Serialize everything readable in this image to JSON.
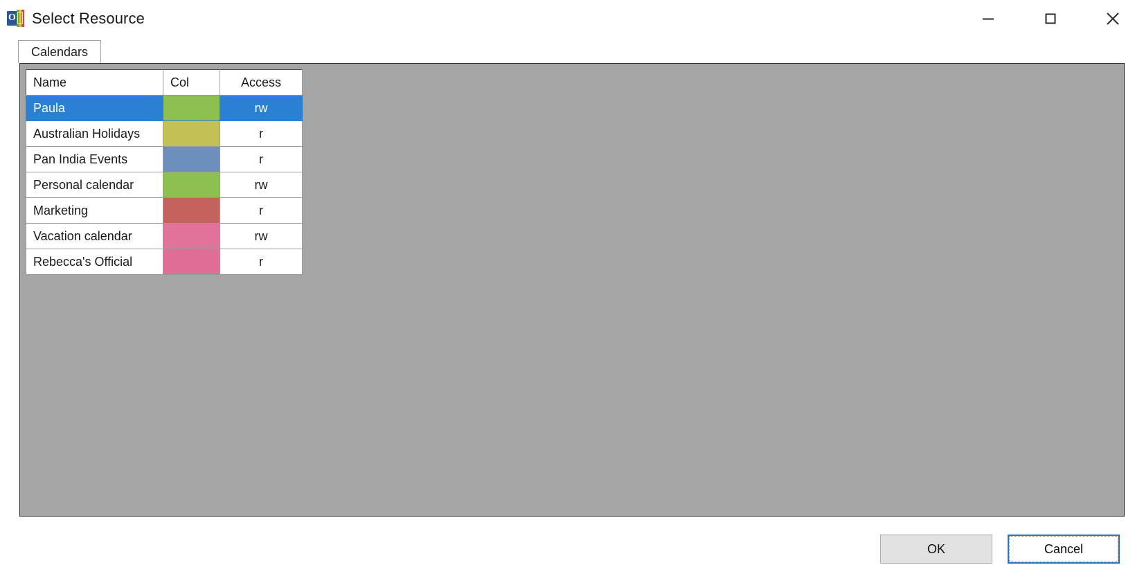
{
  "window": {
    "title": "Select Resource",
    "icon": "outlook-calendar-icon",
    "controls": {
      "minimize": "–",
      "maximize": "□",
      "close": "✕"
    }
  },
  "tabs": [
    {
      "label": "Calendars",
      "active": true
    }
  ],
  "grid": {
    "columns": [
      "Name",
      "Col",
      "Access"
    ],
    "rows": [
      {
        "name": "Paula",
        "color": "#8CC152",
        "access": "rw",
        "selected": true
      },
      {
        "name": "Australian Holidays",
        "color": "#C2C155",
        "access": "r",
        "selected": false
      },
      {
        "name": "Pan India Events",
        "color": "#6E8FBE",
        "access": "r",
        "selected": false
      },
      {
        "name": "Personal calendar",
        "color": "#8CC152",
        "access": "rw",
        "selected": false
      },
      {
        "name": "Marketing",
        "color": "#C4625D",
        "access": "r",
        "selected": false
      },
      {
        "name": "Vacation calendar",
        "color": "#E0729B",
        "access": "rw",
        "selected": false
      },
      {
        "name": "Rebecca's Official",
        "color": "#DE6E97",
        "access": "r",
        "selected": false
      }
    ]
  },
  "footer": {
    "ok_label": "OK",
    "cancel_label": "Cancel"
  },
  "colors": {
    "selection": "#2A80D2",
    "panel_background": "#A5A5A5",
    "default_button_border": "#2A74C4"
  }
}
